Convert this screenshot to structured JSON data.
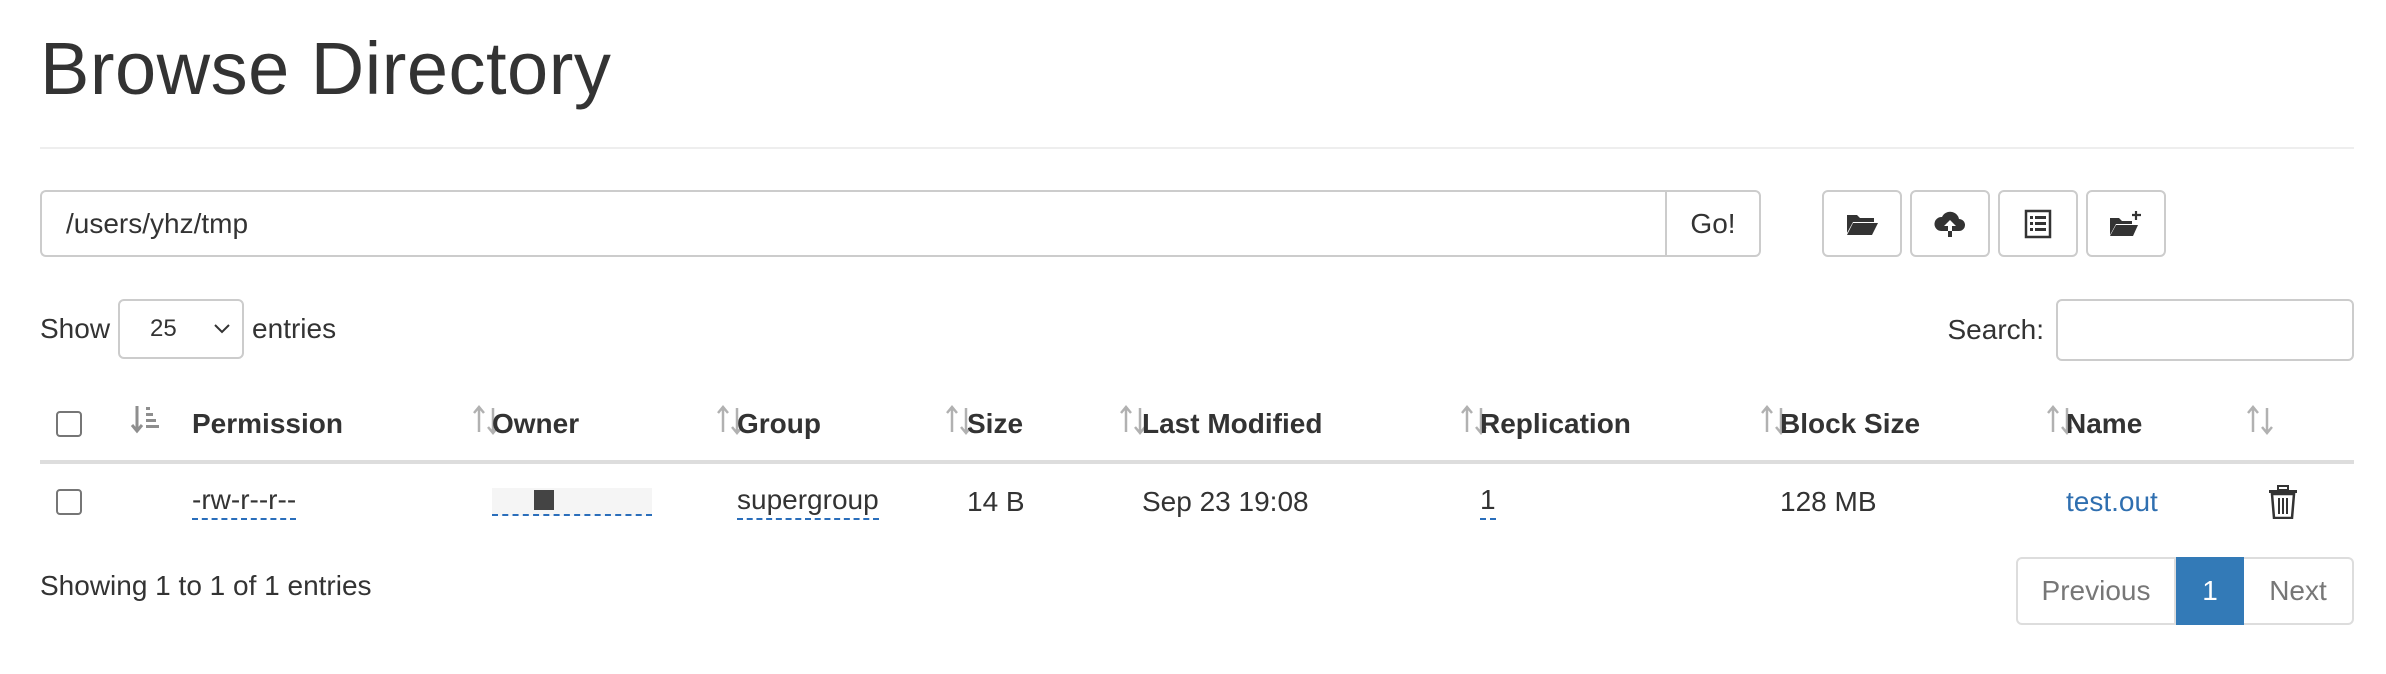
{
  "page": {
    "title": "Browse Directory"
  },
  "path_bar": {
    "value": "/users/yhz/tmp",
    "go_label": "Go!"
  },
  "toolbar": {
    "buttons": [
      {
        "icon": "folder-open-icon"
      },
      {
        "icon": "cloud-upload-icon"
      },
      {
        "icon": "list-alt-icon"
      },
      {
        "icon": "folder-plus-icon"
      }
    ]
  },
  "length_menu": {
    "show_label": "Show",
    "selected": "25",
    "entries_label": "entries"
  },
  "search": {
    "label": "Search:",
    "value": ""
  },
  "table": {
    "columns": [
      "Permission",
      "Owner",
      "Group",
      "Size",
      "Last Modified",
      "Replication",
      "Block Size",
      "Name"
    ],
    "rows": [
      {
        "permission": "-rw-r--r--",
        "owner": "",
        "group": "supergroup",
        "size": "14 B",
        "last_modified": "Sep 23 19:08",
        "replication": "1",
        "block_size": "128 MB",
        "name": "test.out"
      }
    ]
  },
  "info": {
    "text": "Showing 1 to 1 of 1 entries"
  },
  "pagination": {
    "previous": "Previous",
    "current": "1",
    "next": "Next"
  },
  "colors": {
    "link": "#2f6fb0",
    "active_page": "#337ab7"
  }
}
